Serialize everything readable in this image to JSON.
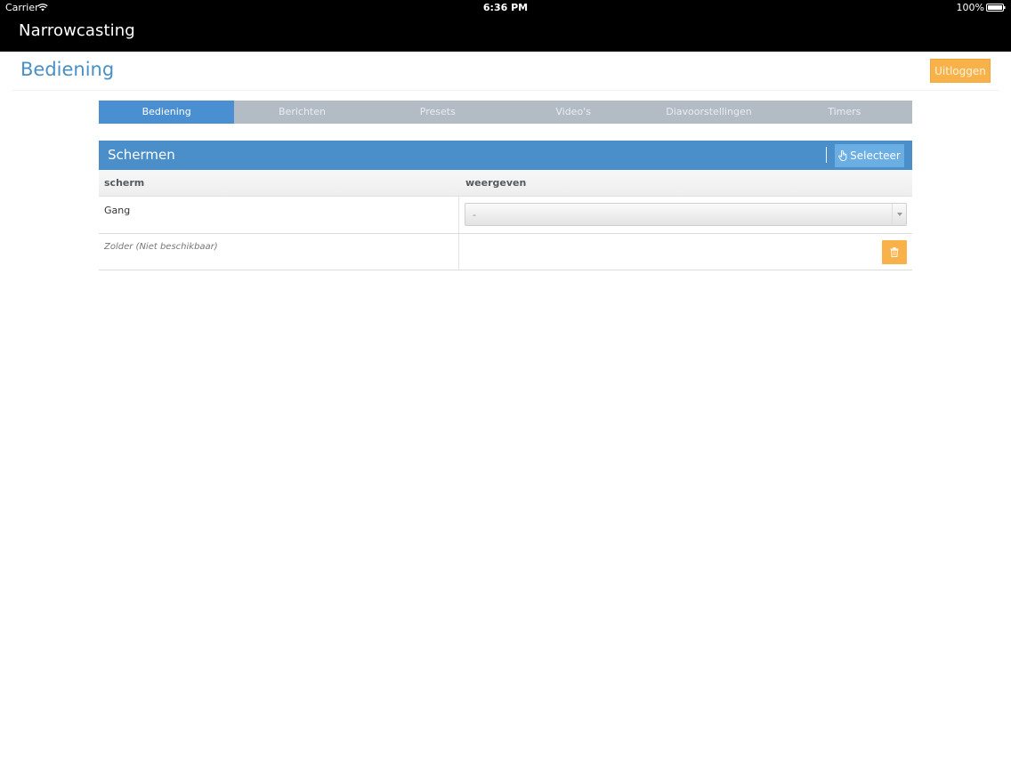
{
  "status_bar": {
    "carrier": "Carrier",
    "time": "6:36 PM",
    "battery": "100%"
  },
  "app": {
    "title": "Narrowcasting"
  },
  "header": {
    "page_title": "Bediening",
    "logout_label": "Uitloggen"
  },
  "tabs": [
    {
      "label": "Bediening",
      "active": true
    },
    {
      "label": "Berichten",
      "active": false
    },
    {
      "label": "Presets",
      "active": false
    },
    {
      "label": "Video's",
      "active": false
    },
    {
      "label": "Diavoorstellingen",
      "active": false
    },
    {
      "label": "Timers",
      "active": false
    }
  ],
  "panel": {
    "title": "Schermen",
    "select_label": "Selecteer",
    "columns": [
      "scherm",
      "weergeven"
    ],
    "rows": [
      {
        "screen": "Gang",
        "display_value": "-"
      },
      {
        "screen": "Zolder (Niet beschikbaar)"
      }
    ]
  },
  "colors": {
    "accent_blue": "#4a8fc9",
    "active_tab": "#4a8fd1",
    "orange": "#f9b14a",
    "page_title": "#4a90c4"
  },
  "icons": {
    "select_button_icon": "hand-pointer-icon",
    "delete_icon": "trash-icon"
  }
}
